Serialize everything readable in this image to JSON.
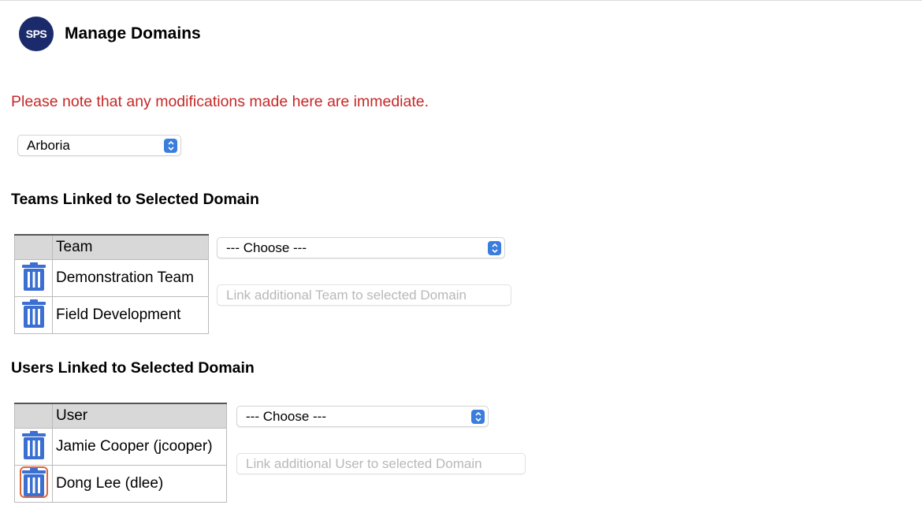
{
  "header": {
    "logo_text": "SPS",
    "title": "Manage Domains"
  },
  "notice": "Please note that any modifications made here are immediate.",
  "domain_select": {
    "value": "Arboria"
  },
  "teams": {
    "heading": "Teams Linked to Selected Domain",
    "column_header": "Team",
    "rows": [
      "Demonstration Team",
      "Field Development"
    ],
    "choose_select": "--- Choose ---",
    "link_button": "Link additional Team to selected Domain"
  },
  "users": {
    "heading": "Users Linked to Selected Domain",
    "column_header": "User",
    "rows": [
      "Jamie Cooper (jcooper)",
      "Dong Lee (dlee)"
    ],
    "choose_select": "--- Choose ---",
    "link_button": "Link additional User to selected Domain"
  },
  "colors": {
    "notice": "#c62828",
    "logo": "#1b2a6b",
    "trash_icon": "#3b6fd1",
    "selection_outline": "#e0663a"
  },
  "icons": {
    "delete": "trash-icon",
    "select_arrows": "chevron-up-down-icon"
  }
}
